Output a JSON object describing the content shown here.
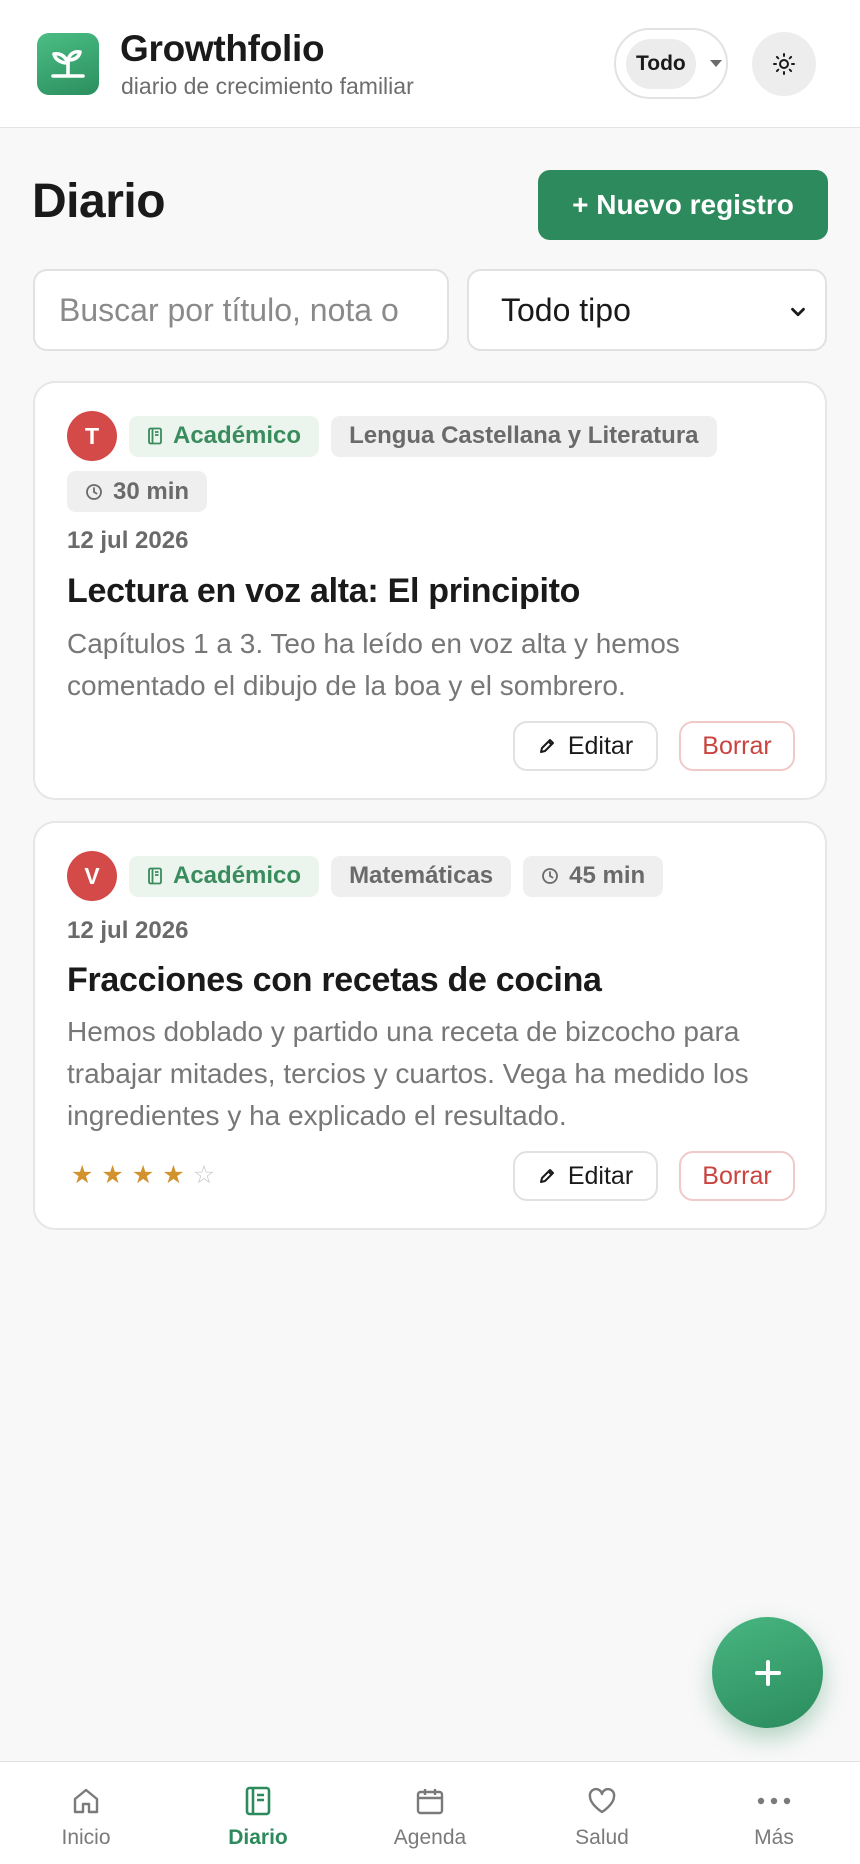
{
  "header": {
    "app_name": "Growthfolio",
    "tagline": "diario de crecimiento familiar",
    "child_filter": "Todo",
    "theme_icon": "sun-icon",
    "logo_icon": "sprout-icon"
  },
  "page": {
    "title": "Diario",
    "new_button": "+ Nuevo registro"
  },
  "filters": {
    "search_placeholder": "Buscar por título, nota o",
    "search_value": "",
    "type_selected": "Todo tipo"
  },
  "entries": [
    {
      "avatar": "T",
      "category": "Académico",
      "subject": "Lengua Castellana y Literatura",
      "duration": "30 min",
      "date": "12 jul 2026",
      "title": "Lectura en voz alta: El principito",
      "note": "Capítulos 1 a 3. Teo ha leído en voz alta y hemos comentado el dibujo de la boa y el sombrero.",
      "edit_label": "Editar",
      "delete_label": "Borrar"
    },
    {
      "avatar": "V",
      "category": "Académico",
      "subject": "Matemáticas",
      "duration": "45 min",
      "date": "12 jul 2026",
      "title": "Fracciones con recetas de cocina",
      "note": "Hemos doblado y partido una receta de bizcocho para trabajar mitades, tercios y cuartos. Vega ha medido los ingredientes y ha explicado el resultado.",
      "rating": 4,
      "rating_max": 5,
      "edit_label": "Editar",
      "delete_label": "Borrar"
    }
  ],
  "fab": {
    "icon": "plus-icon"
  },
  "nav": [
    {
      "label": "Inicio",
      "icon": "home-icon",
      "active": false
    },
    {
      "label": "Diario",
      "icon": "journal-icon",
      "active": true
    },
    {
      "label": "Agenda",
      "icon": "calendar-icon",
      "active": false
    },
    {
      "label": "Salud",
      "icon": "heart-icon",
      "active": false
    },
    {
      "label": "Más",
      "icon": "more-icon",
      "active": false
    }
  ],
  "colors": {
    "brand": "#2c8a5c",
    "avatar": "#d44a48",
    "danger": "#c9443f",
    "star": "#d2922e"
  }
}
